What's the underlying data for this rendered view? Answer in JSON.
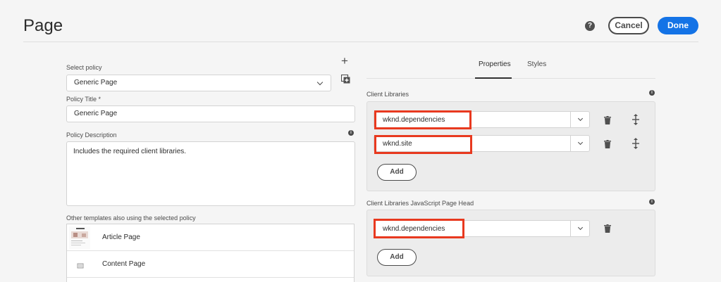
{
  "header": {
    "title": "Page",
    "help_icon": "?",
    "cancel_label": "Cancel",
    "done_label": "Done",
    "accent": "#1473e6"
  },
  "left": {
    "select_policy_label": "Select policy",
    "select_policy_value": "Generic Page",
    "policy_title_label": "Policy Title *",
    "policy_title_value": "Generic Page",
    "policy_description_label": "Policy Description",
    "policy_description_value": "Includes the required client libraries.",
    "other_templates_label": "Other templates also using the selected policy",
    "templates": [
      {
        "label": "Article Page",
        "icon": "article-thumbnail"
      },
      {
        "label": "Content Page",
        "icon": "page-icon"
      }
    ]
  },
  "tabs": [
    {
      "label": "Properties",
      "active": true
    },
    {
      "label": "Styles",
      "active": false
    }
  ],
  "client_libraries": {
    "label": "Client Libraries",
    "items": [
      {
        "value": "wknd.dependencies"
      },
      {
        "value": "wknd.site"
      }
    ],
    "add_label": "Add"
  },
  "client_libraries_head": {
    "label": "Client Libraries JavaScript Page Head",
    "items": [
      {
        "value": "wknd.dependencies"
      }
    ],
    "add_label": "Add"
  },
  "highlight_color": "#e8391f"
}
